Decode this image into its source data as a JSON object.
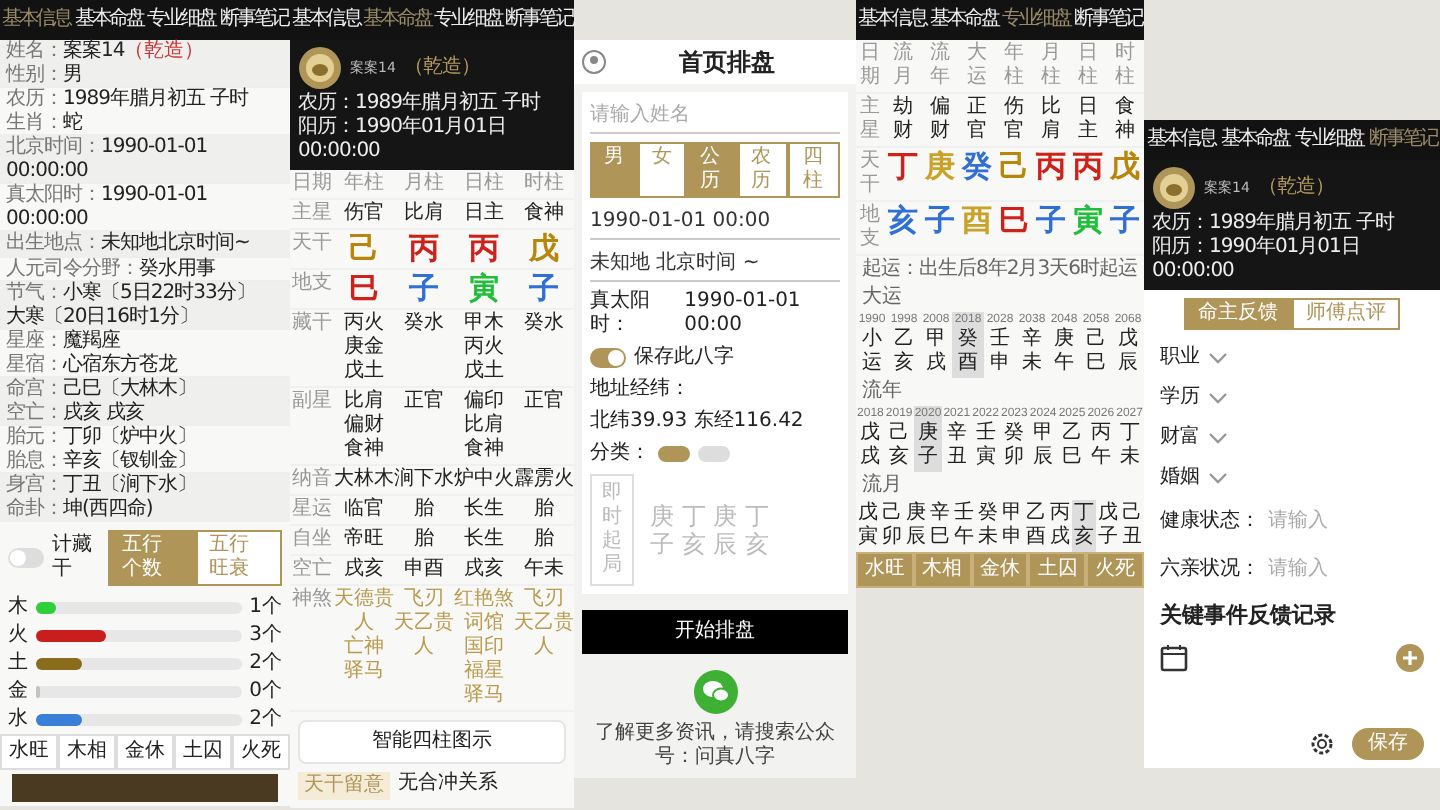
{
  "info_panel": {
    "tabs": [
      {
        "label": "基本信息",
        "selected": true
      },
      {
        "label": "基本命盘",
        "selected": false
      },
      {
        "label": "专业细盘",
        "selected": false
      },
      {
        "label": "断事笔记",
        "selected": false
      }
    ],
    "rows": [
      [
        {
          "label": "姓名：",
          "value": "案案14",
          "tag": "（乾造）"
        },
        {
          "label": "性别：",
          "value": "男"
        }
      ],
      [
        {
          "label": "农历：",
          "value": "1989年腊月初五 子时"
        },
        {
          "label": "生肖：",
          "value": "蛇"
        }
      ],
      [
        {
          "label": "北京时间：",
          "value": "1990-01-01 00:00:00"
        }
      ],
      [
        {
          "label": "真太阳时：",
          "value": "1990-01-01 00:00:00"
        }
      ],
      [
        {
          "label": "出生地点：",
          "value": "未知地北京时间~"
        }
      ],
      [
        {
          "label": "人元司令分野：",
          "value": "癸水用事"
        }
      ],
      [
        {
          "label": "节气：",
          "value": "小寒〔5日22时33分〕"
        },
        {
          "value": "大寒〔20日16时1分〕"
        }
      ],
      [
        {
          "label": "星座：",
          "value": "魔羯座"
        },
        {
          "label": "星宿：",
          "value": "心宿东方苍龙"
        }
      ],
      [
        {
          "label": "命宫：",
          "value": "己巳〔大林木〕"
        },
        {
          "label": "空亡：",
          "value": "戌亥 戌亥"
        }
      ],
      [
        {
          "label": "胎元：",
          "value": "丁卯〔炉中火〕"
        },
        {
          "label": "胎息：",
          "value": "辛亥〔钗钏金〕"
        }
      ],
      [
        {
          "label": "身宫：",
          "value": "丁丑〔涧下水〕"
        },
        {
          "label": "命卦：",
          "value": "坤(西四命)"
        }
      ]
    ],
    "toggle": {
      "label": "计藏干",
      "on": false
    },
    "modes": [
      {
        "label": "五行个数",
        "selected": true
      },
      {
        "label": "五行旺衰",
        "selected": false
      }
    ],
    "elements": [
      {
        "name": "木",
        "level": 0.1,
        "count": "1个",
        "color": "#2fcf3a"
      },
      {
        "name": "火",
        "level": 0.34,
        "count": "3个",
        "color": "#c81e1e"
      },
      {
        "name": "土",
        "level": 0.22,
        "count": "2个",
        "color": "#8a6d1c"
      },
      {
        "name": "金",
        "level": 0,
        "count": "0个"
      },
      {
        "name": "水",
        "level": 0.22,
        "count": "2个",
        "color": "#3a7fd8"
      }
    ],
    "seasons": [
      "水旺",
      "木相",
      "金休",
      "土囚",
      "火死"
    ]
  },
  "chart_panel": {
    "tabs": [
      {
        "label": "基本信息",
        "selected": false
      },
      {
        "label": "基本命盘",
        "selected": true
      },
      {
        "label": "专业细盘",
        "selected": false
      },
      {
        "label": "断事笔记",
        "selected": false
      }
    ],
    "header": {
      "avatar_label": "案案14",
      "lunar": "农历：1989年腊月初五 子时",
      "tag": "（乾造）",
      "solar": "阳历：1990年01月01日 00:00:00"
    },
    "table": {
      "corner": "日期",
      "columns": [
        "年柱",
        "月柱",
        "日柱",
        "时柱"
      ],
      "rows": [
        {
          "label": "主星",
          "kind": "text",
          "cells": [
            "伤官",
            "比肩",
            "日主",
            "食神"
          ]
        },
        {
          "label": "天干",
          "kind": "glyph",
          "cells": [
            {
              "text": "己",
              "color": "#b8860b"
            },
            {
              "text": "丙",
              "color": "#d0201a"
            },
            {
              "text": "丙",
              "color": "#d0201a"
            },
            {
              "text": "戊",
              "color": "#b8860b"
            }
          ]
        },
        {
          "label": "地支",
          "kind": "glyph",
          "cells": [
            {
              "text": "巳",
              "color": "#d0201a"
            },
            {
              "text": "子",
              "color": "#2f6fd6"
            },
            {
              "text": "寅",
              "color": "#1fbf3a"
            },
            {
              "text": "子",
              "color": "#2f6fd6"
            }
          ]
        },
        {
          "label": "藏干",
          "kind": "stack",
          "cells": [
            [
              "丙火",
              "庚金",
              "戊土"
            ],
            [
              "癸水"
            ],
            [
              "甲木",
              "丙火",
              "戊土"
            ],
            [
              "癸水"
            ]
          ]
        },
        {
          "label": "副星",
          "kind": "stack",
          "cells": [
            [
              "比肩",
              "偏财",
              "食神"
            ],
            [
              "正官"
            ],
            [
              "偏印",
              "比肩",
              "食神"
            ],
            [
              "正官"
            ]
          ]
        },
        {
          "label": "纳音",
          "kind": "text",
          "cells": [
            "大林木",
            "涧下水",
            "炉中火",
            "霹雳火"
          ]
        },
        {
          "label": "星运",
          "kind": "text",
          "cells": [
            "临官",
            "胎",
            "长生",
            "胎"
          ]
        },
        {
          "label": "自坐",
          "kind": "text",
          "cells": [
            "帝旺",
            "胎",
            "长生",
            "胎"
          ]
        },
        {
          "label": "空亡",
          "kind": "text",
          "cells": [
            "戌亥",
            "申酉",
            "戌亥",
            "午未"
          ]
        },
        {
          "label": "神煞",
          "kind": "gold",
          "cells": [
            [
              "天德贵人",
              "亡神",
              "驿马"
            ],
            [
              "飞刃",
              "天乙贵人"
            ],
            [
              "红艳煞",
              "词馆",
              "国印",
              "福星",
              "驿马"
            ],
            [
              "飞刃",
              "天乙贵人"
            ]
          ]
        }
      ]
    },
    "button": "智能四柱图示",
    "tag": "天干留意",
    "tag_text": "无合冲关系"
  },
  "home_panel": {
    "title": "首页排盘",
    "name_field": {
      "placeholder": "请输入姓名"
    },
    "genders": [
      {
        "label": "男",
        "selected": true
      },
      {
        "label": "女",
        "selected": false
      }
    ],
    "calendars": [
      {
        "label": "公历",
        "selected": true
      },
      {
        "label": "农历",
        "selected": false
      },
      {
        "label": "四柱",
        "selected": false
      }
    ],
    "date": "1990-01-01 00:00",
    "location": "未知地 北京时间 ~",
    "solar_label": "真太阳时：",
    "solar_value": "1990-01-01 00:00",
    "save_toggle": {
      "label": "保存此八字",
      "on": true
    },
    "coords_label": "地址经纬：",
    "coords": "北纬39.93 东经116.42",
    "category_label": "分类：",
    "categories": [
      {
        "selected": true
      },
      {
        "selected": false
      }
    ],
    "instant": {
      "label": "即时起局",
      "stems": "庚 丁 庚 丁",
      "branches": "子 亥 辰 亥"
    },
    "submit": "开始排盘",
    "footer": "了解更多资讯，请搜索公众号：问真八字"
  },
  "pro_panel": {
    "tabs": [
      {
        "label": "基本信息",
        "selected": false
      },
      {
        "label": "基本命盘",
        "selected": false
      },
      {
        "label": "专业细盘",
        "selected": true
      },
      {
        "label": "断事笔记",
        "selected": false
      }
    ],
    "table": {
      "corner": "日期",
      "columns": [
        "流月",
        "流年",
        "大运",
        "年柱",
        "月柱",
        "日柱",
        "时柱"
      ],
      "rows": [
        {
          "label": "主星",
          "kind": "text",
          "cells": [
            "劫财",
            "偏财",
            "正官",
            "伤官",
            "比肩",
            "日主",
            "食神"
          ]
        },
        {
          "label": "天干",
          "kind": "glyph",
          "cells": [
            {
              "text": "丁",
              "color": "#d0201a"
            },
            {
              "text": "庚",
              "color": "#c9a227"
            },
            {
              "text": "癸",
              "color": "#2f6fd6"
            },
            {
              "text": "己",
              "color": "#b8860b"
            },
            {
              "text": "丙",
              "color": "#d0201a"
            },
            {
              "text": "丙",
              "color": "#d0201a"
            },
            {
              "text": "戊",
              "color": "#b8860b"
            }
          ]
        },
        {
          "label": "地支",
          "kind": "glyph",
          "cells": [
            {
              "text": "亥",
              "color": "#2f6fd6"
            },
            {
              "text": "子",
              "color": "#2f6fd6"
            },
            {
              "text": "酉",
              "color": "#c9a227"
            },
            {
              "text": "巳",
              "color": "#d0201a"
            },
            {
              "text": "子",
              "color": "#2f6fd6"
            },
            {
              "text": "寅",
              "color": "#1fbf3a"
            },
            {
              "text": "子",
              "color": "#2f6fd6"
            }
          ]
        }
      ]
    },
    "qiyun": "起运：出生后8年2月3天6时起运",
    "sections": [
      {
        "label": "大运",
        "items": [
          {
            "year": "1990",
            "stem": "小",
            "branch": "运",
            "selected": false
          },
          {
            "year": "1998",
            "stem": "乙",
            "branch": "亥",
            "selected": false
          },
          {
            "year": "2008",
            "stem": "甲",
            "branch": "戌",
            "selected": false
          },
          {
            "year": "2018",
            "stem": "癸",
            "branch": "酉",
            "selected": true
          },
          {
            "year": "2028",
            "stem": "壬",
            "branch": "申",
            "selected": false
          },
          {
            "year": "2038",
            "stem": "辛",
            "branch": "未",
            "selected": false
          },
          {
            "year": "2048",
            "stem": "庚",
            "branch": "午",
            "selected": false
          },
          {
            "year": "2058",
            "stem": "己",
            "branch": "巳",
            "selected": false
          },
          {
            "year": "2068",
            "stem": "戊",
            "branch": "辰",
            "selected": false
          }
        ]
      },
      {
        "label": "流年",
        "items": [
          {
            "year": "2018",
            "stem": "戊",
            "branch": "戌",
            "selected": false
          },
          {
            "year": "2019",
            "stem": "己",
            "branch": "亥",
            "selected": false
          },
          {
            "year": "2020",
            "stem": "庚",
            "branch": "子",
            "selected": true
          },
          {
            "year": "2021",
            "stem": "辛",
            "branch": "丑",
            "selected": false
          },
          {
            "year": "2022",
            "stem": "壬",
            "branch": "寅",
            "selected": false
          },
          {
            "year": "2023",
            "stem": "癸",
            "branch": "卯",
            "selected": false
          },
          {
            "year": "2024",
            "stem": "甲",
            "branch": "辰",
            "selected": false
          },
          {
            "year": "2025",
            "stem": "乙",
            "branch": "巳",
            "selected": false
          },
          {
            "year": "2026",
            "stem": "丙",
            "branch": "午",
            "selected": false
          },
          {
            "year": "2027",
            "stem": "丁",
            "branch": "未",
            "selected": false
          }
        ]
      },
      {
        "label": "流月",
        "items": [
          {
            "stem": "戊",
            "branch": "寅",
            "selected": false
          },
          {
            "stem": "己",
            "branch": "卯",
            "selected": false
          },
          {
            "stem": "庚",
            "branch": "辰",
            "selected": false
          },
          {
            "stem": "辛",
            "branch": "巳",
            "selected": false
          },
          {
            "stem": "壬",
            "branch": "午",
            "selected": false
          },
          {
            "stem": "癸",
            "branch": "未",
            "selected": false
          },
          {
            "stem": "甲",
            "branch": "申",
            "selected": false
          },
          {
            "stem": "乙",
            "branch": "酉",
            "selected": false
          },
          {
            "stem": "丙",
            "branch": "戌",
            "selected": false
          },
          {
            "stem": "丁",
            "branch": "亥",
            "selected": true
          },
          {
            "stem": "戊",
            "branch": "子",
            "selected": false
          },
          {
            "stem": "己",
            "branch": "丑",
            "selected": false
          }
        ]
      }
    ],
    "seasons": [
      "水旺",
      "木相",
      "金休",
      "土囚",
      "火死"
    ]
  },
  "notes_panel": {
    "tabs": [
      {
        "label": "基本信息",
        "selected": false
      },
      {
        "label": "基本命盘",
        "selected": false
      },
      {
        "label": "专业细盘",
        "selected": false
      },
      {
        "label": "断事笔记",
        "selected": true
      }
    ],
    "header": {
      "avatar_label": "案案14",
      "lunar": "农历：1989年腊月初五 子时",
      "tag": "（乾造）",
      "solar": "阳历：1990年01月01日 00:00:00"
    },
    "modes": [
      {
        "label": "命主反馈",
        "selected": true
      },
      {
        "label": "师傅点评",
        "selected": false
      }
    ],
    "fields": [
      {
        "kind": "select",
        "label": "职业"
      },
      {
        "kind": "select",
        "label": "学历"
      },
      {
        "kind": "select",
        "label": "财富"
      },
      {
        "kind": "select",
        "label": "婚姻"
      },
      {
        "kind": "input",
        "label": "健康状态：",
        "placeholder": "请输入"
      },
      {
        "kind": "input",
        "label": "六亲状况：",
        "placeholder": "请输入"
      }
    ],
    "section_title": "关键事件反馈记录",
    "save": "保存"
  }
}
